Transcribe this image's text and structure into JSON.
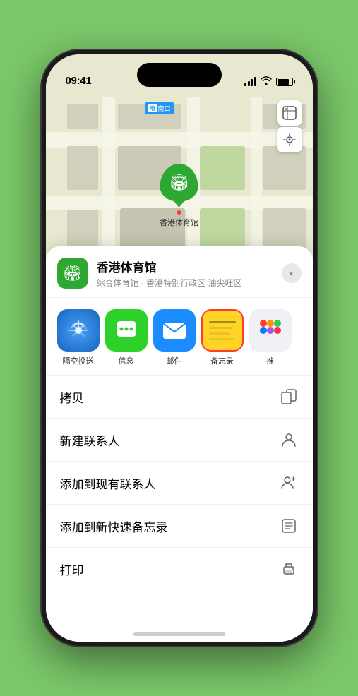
{
  "phone": {
    "status_bar": {
      "time": "09:41",
      "signal_label": "signal",
      "wifi_label": "wifi",
      "battery_label": "battery"
    },
    "map": {
      "subway_label": "南口",
      "controls": {
        "map_type_icon": "🗺",
        "location_icon": "➤"
      },
      "pin": {
        "label": "香港体育馆",
        "dot_label": "pin-dot"
      }
    },
    "bottom_sheet": {
      "location": {
        "name": "香港体育馆",
        "subtitle": "综合体育馆 · 香港特别行政区 油尖旺区",
        "close_label": "×"
      },
      "share_apps": [
        {
          "id": "airdrop",
          "label": "隔空投送"
        },
        {
          "id": "messages",
          "label": "信息"
        },
        {
          "id": "mail",
          "label": "邮件"
        },
        {
          "id": "notes",
          "label": "备忘录"
        },
        {
          "id": "more",
          "label": "推"
        }
      ],
      "actions": [
        {
          "id": "copy",
          "label": "拷贝",
          "icon": "copy"
        },
        {
          "id": "new-contact",
          "label": "新建联系人",
          "icon": "person"
        },
        {
          "id": "add-to-contact",
          "label": "添加到现有联系人",
          "icon": "person-add"
        },
        {
          "id": "add-to-notes",
          "label": "添加到新快速备忘录",
          "icon": "note"
        },
        {
          "id": "print",
          "label": "打印",
          "icon": "print"
        }
      ]
    }
  }
}
